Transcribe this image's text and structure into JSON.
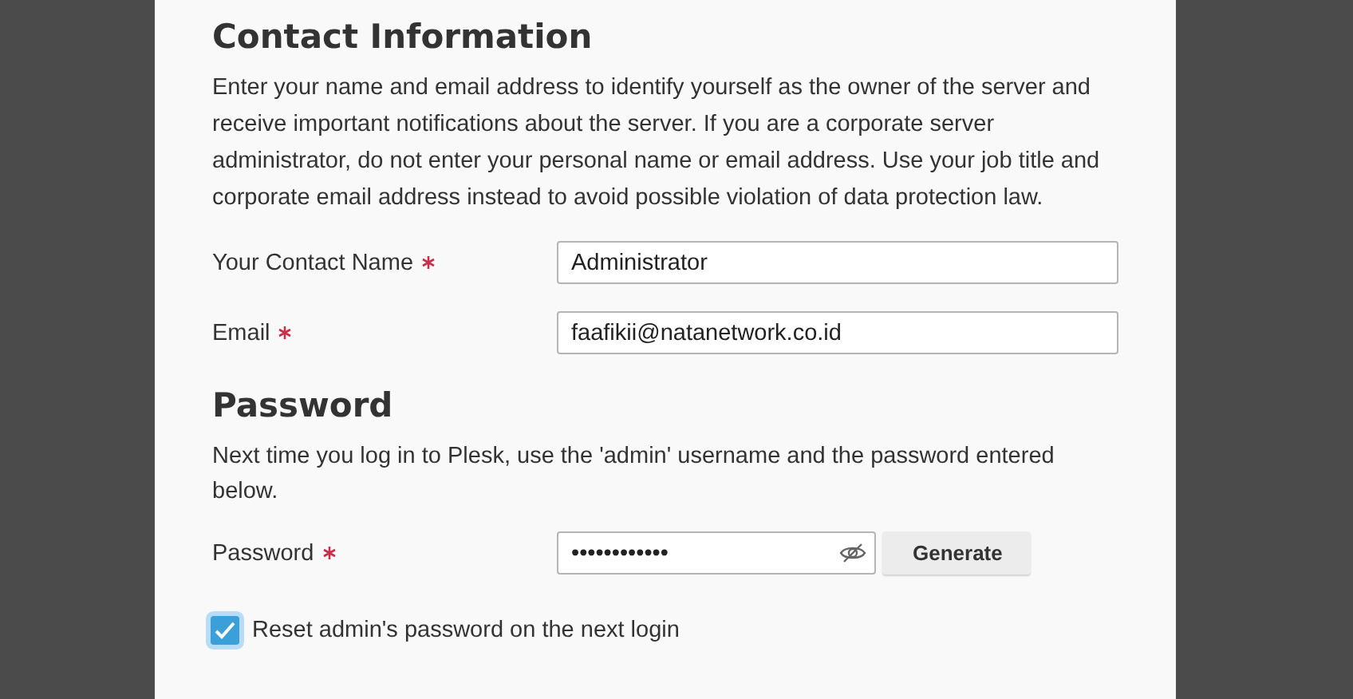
{
  "contact": {
    "heading": "Contact Information",
    "description": "Enter your name and email address to identify yourself as the owner of the server and receive important notifications about the server. If you are a corporate server administrator, do not enter your personal name or email address. Use your job title and corporate email address instead to avoid possible violation of data protection law.",
    "fields": [
      {
        "label": "Your Contact Name",
        "required": true,
        "value": "Administrator"
      },
      {
        "label": "Email",
        "required": true,
        "value": "faafikii@natanetwork.co.id"
      }
    ]
  },
  "password": {
    "heading": "Password",
    "description": "Next time you log in to Plesk, use the 'admin' username and the password entered below.",
    "label": "Password",
    "required": true,
    "value": "••••••••••••",
    "generate_button": "Generate",
    "reset_checkbox": {
      "label": "Reset admin's password on the next login",
      "checked": true
    }
  }
}
